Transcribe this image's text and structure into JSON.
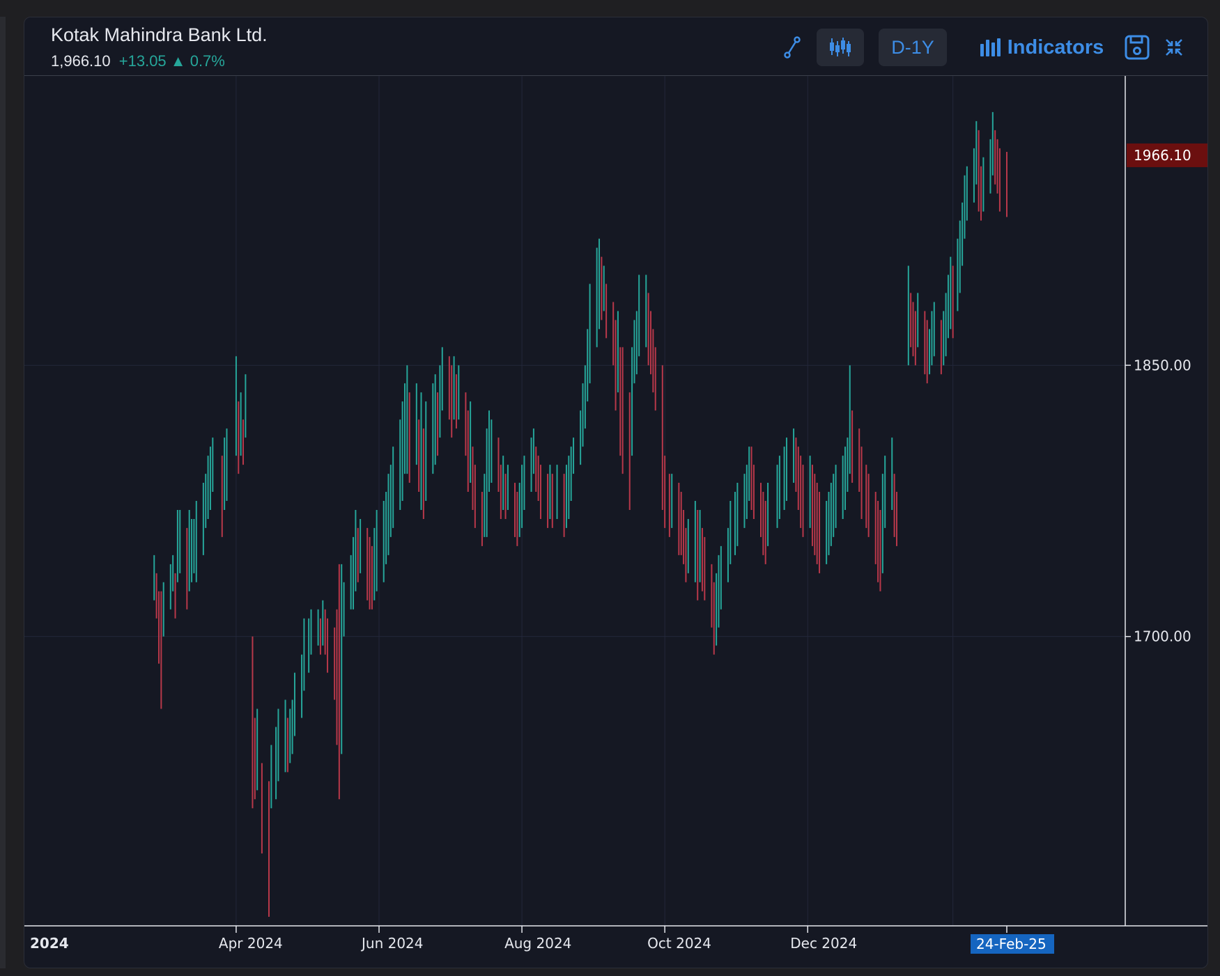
{
  "header": {
    "title": "Kotak Mahindra Bank Ltd.",
    "price": "1,966.10",
    "change": "+13.05",
    "change_pct": "0.7%"
  },
  "toolbar": {
    "period_label": "D-1Y",
    "indicators_label": "Indicators",
    "icons": [
      "draw-tool-icon",
      "candlestick-icon",
      "bar-chart-icon",
      "save-icon",
      "collapse-icon"
    ]
  },
  "colors": {
    "background": "#151823",
    "up": "#26a69a",
    "down": "#b8384a",
    "accent": "#3d8de6",
    "last_price_bg": "#6b0f0f",
    "date_badge_bg": "#1565c0"
  },
  "chart_data": {
    "type": "bar",
    "style": "ohlc-bars",
    "ylim": [
      1540,
      2010
    ],
    "y_ticks": [
      1850,
      1700
    ],
    "y_tick_labels": [
      "1850.00",
      "1700.00"
    ],
    "x_tick_labels": [
      "2024",
      "Apr 2024",
      "Jun 2024",
      "Aug 2024",
      "Oct 2024",
      "Dec 2024"
    ],
    "x_tick_dates": [
      "2024-01-01",
      "2024-04-01",
      "2024-06-01",
      "2024-08-01",
      "2024-10-01",
      "2024-12-01"
    ],
    "last_price_label": "1966.10",
    "last_date_label": "24-Feb-25",
    "grid": true,
    "bars": [
      [
        "2024-02-26",
        1745,
        1720
      ],
      [
        "2024-02-27",
        1735,
        1710
      ],
      [
        "2024-02-28",
        1725,
        1685
      ],
      [
        "2024-02-29",
        1725,
        1660
      ],
      [
        "2024-03-01",
        1730,
        1700
      ],
      [
        "2024-03-04",
        1740,
        1715
      ],
      [
        "2024-03-05",
        1745,
        1725
      ],
      [
        "2024-03-06",
        1735,
        1710
      ],
      [
        "2024-03-07",
        1770,
        1730
      ],
      [
        "2024-03-08",
        1770,
        1735
      ],
      [
        "2024-03-11",
        1760,
        1715
      ],
      [
        "2024-03-12",
        1770,
        1725
      ],
      [
        "2024-03-13",
        1765,
        1730
      ],
      [
        "2024-03-14",
        1765,
        1735
      ],
      [
        "2024-03-15",
        1775,
        1730
      ],
      [
        "2024-03-18",
        1785,
        1745
      ],
      [
        "2024-03-19",
        1790,
        1760
      ],
      [
        "2024-03-20",
        1800,
        1765
      ],
      [
        "2024-03-21",
        1805,
        1770
      ],
      [
        "2024-03-22",
        1810,
        1780
      ],
      [
        "2024-03-26",
        1800,
        1755
      ],
      [
        "2024-03-27",
        1810,
        1770
      ],
      [
        "2024-03-28",
        1815,
        1775
      ],
      [
        "2024-04-01",
        1855,
        1800
      ],
      [
        "2024-04-02",
        1830,
        1790
      ],
      [
        "2024-04-03",
        1835,
        1800
      ],
      [
        "2024-04-04",
        1820,
        1795
      ],
      [
        "2024-04-05",
        1845,
        1810
      ],
      [
        "2024-04-08",
        1700,
        1605
      ],
      [
        "2024-04-09",
        1655,
        1610
      ],
      [
        "2024-04-10",
        1660,
        1615
      ],
      [
        "2024-04-12",
        1630,
        1580
      ],
      [
        "2024-04-15",
        1620,
        1545
      ],
      [
        "2024-04-16",
        1640,
        1605
      ],
      [
        "2024-04-18",
        1650,
        1610
      ],
      [
        "2024-04-19",
        1660,
        1620
      ],
      [
        "2024-04-22",
        1665,
        1625
      ],
      [
        "2024-04-23",
        1655,
        1625
      ],
      [
        "2024-04-24",
        1660,
        1630
      ],
      [
        "2024-04-25",
        1665,
        1635
      ],
      [
        "2024-04-26",
        1680,
        1645
      ],
      [
        "2024-04-29",
        1690,
        1655
      ],
      [
        "2024-04-30",
        1710,
        1670
      ],
      [
        "2024-05-02",
        1710,
        1680
      ],
      [
        "2024-05-03",
        1715,
        1690
      ],
      [
        "2024-05-06",
        1715,
        1695
      ],
      [
        "2024-05-07",
        1710,
        1690
      ],
      [
        "2024-05-08",
        1720,
        1695
      ],
      [
        "2024-05-09",
        1715,
        1690
      ],
      [
        "2024-05-10",
        1710,
        1680
      ],
      [
        "2024-05-13",
        1705,
        1665
      ],
      [
        "2024-05-14",
        1715,
        1640
      ],
      [
        "2024-05-15",
        1740,
        1610
      ],
      [
        "2024-05-16",
        1740,
        1635
      ],
      [
        "2024-05-17",
        1730,
        1700
      ],
      [
        "2024-05-20",
        1745,
        1715
      ],
      [
        "2024-05-21",
        1755,
        1715
      ],
      [
        "2024-05-22",
        1770,
        1725
      ],
      [
        "2024-05-23",
        1760,
        1730
      ],
      [
        "2024-05-24",
        1765,
        1735
      ],
      [
        "2024-05-27",
        1760,
        1720
      ],
      [
        "2024-05-28",
        1755,
        1715
      ],
      [
        "2024-05-29",
        1750,
        1715
      ],
      [
        "2024-05-30",
        1760,
        1720
      ],
      [
        "2024-05-31",
        1770,
        1725
      ],
      [
        "2024-06-03",
        1775,
        1730
      ],
      [
        "2024-06-04",
        1780,
        1740
      ],
      [
        "2024-06-05",
        1790,
        1745
      ],
      [
        "2024-06-06",
        1795,
        1755
      ],
      [
        "2024-06-07",
        1805,
        1760
      ],
      [
        "2024-06-10",
        1820,
        1770
      ],
      [
        "2024-06-11",
        1830,
        1775
      ],
      [
        "2024-06-12",
        1840,
        1790
      ],
      [
        "2024-06-13",
        1850,
        1790
      ],
      [
        "2024-06-14",
        1835,
        1785
      ],
      [
        "2024-06-17",
        1840,
        1795
      ],
      [
        "2024-06-18",
        1820,
        1780
      ],
      [
        "2024-06-19",
        1835,
        1770
      ],
      [
        "2024-06-20",
        1815,
        1765
      ],
      [
        "2024-06-21",
        1830,
        1775
      ],
      [
        "2024-06-24",
        1840,
        1790
      ],
      [
        "2024-06-25",
        1845,
        1795
      ],
      [
        "2024-06-26",
        1835,
        1800
      ],
      [
        "2024-06-27",
        1850,
        1810
      ],
      [
        "2024-06-28",
        1860,
        1825
      ],
      [
        "2024-07-01",
        1855,
        1820
      ],
      [
        "2024-07-02",
        1850,
        1810
      ],
      [
        "2024-07-03",
        1855,
        1820
      ],
      [
        "2024-07-04",
        1845,
        1815
      ],
      [
        "2024-07-05",
        1850,
        1820
      ],
      [
        "2024-07-08",
        1835,
        1800
      ],
      [
        "2024-07-09",
        1825,
        1780
      ],
      [
        "2024-07-10",
        1830,
        1785
      ],
      [
        "2024-07-11",
        1805,
        1770
      ],
      [
        "2024-07-12",
        1795,
        1760
      ],
      [
        "2024-07-15",
        1780,
        1750
      ],
      [
        "2024-07-16",
        1790,
        1755
      ],
      [
        "2024-07-17",
        1815,
        1755
      ],
      [
        "2024-07-18",
        1825,
        1780
      ],
      [
        "2024-07-19",
        1820,
        1785
      ],
      [
        "2024-07-22",
        1810,
        1780
      ],
      [
        "2024-07-23",
        1795,
        1765
      ],
      [
        "2024-07-24",
        1800,
        1770
      ],
      [
        "2024-07-25",
        1790,
        1765
      ],
      [
        "2024-07-26",
        1795,
        1770
      ],
      [
        "2024-07-29",
        1785,
        1755
      ],
      [
        "2024-07-30",
        1780,
        1750
      ],
      [
        "2024-07-31",
        1785,
        1755
      ],
      [
        "2024-08-01",
        1795,
        1760
      ],
      [
        "2024-08-02",
        1800,
        1770
      ],
      [
        "2024-08-05",
        1810,
        1780
      ],
      [
        "2024-08-06",
        1815,
        1790
      ],
      [
        "2024-08-07",
        1805,
        1780
      ],
      [
        "2024-08-08",
        1800,
        1775
      ],
      [
        "2024-08-09",
        1795,
        1765
      ],
      [
        "2024-08-12",
        1790,
        1760
      ],
      [
        "2024-08-13",
        1795,
        1765
      ],
      [
        "2024-08-14",
        1790,
        1760
      ],
      [
        "2024-08-16",
        1795,
        1765
      ],
      [
        "2024-08-19",
        1790,
        1755
      ],
      [
        "2024-08-20",
        1795,
        1760
      ],
      [
        "2024-08-21",
        1800,
        1765
      ],
      [
        "2024-08-22",
        1805,
        1775
      ],
      [
        "2024-08-23",
        1810,
        1790
      ],
      [
        "2024-08-26",
        1825,
        1795
      ],
      [
        "2024-08-27",
        1840,
        1805
      ],
      [
        "2024-08-28",
        1850,
        1815
      ],
      [
        "2024-08-29",
        1870,
        1830
      ],
      [
        "2024-08-30",
        1895,
        1840
      ],
      [
        "2024-09-02",
        1915,
        1860
      ],
      [
        "2024-09-03",
        1920,
        1870
      ],
      [
        "2024-09-04",
        1910,
        1875
      ],
      [
        "2024-09-05",
        1905,
        1880
      ],
      [
        "2024-09-06",
        1895,
        1865
      ],
      [
        "2024-09-09",
        1885,
        1850
      ],
      [
        "2024-09-10",
        1875,
        1825
      ],
      [
        "2024-09-11",
        1880,
        1835
      ],
      [
        "2024-09-12",
        1860,
        1800
      ],
      [
        "2024-09-13",
        1860,
        1790
      ],
      [
        "2024-09-16",
        1835,
        1770
      ],
      [
        "2024-09-17",
        1860,
        1800
      ],
      [
        "2024-09-18",
        1875,
        1840
      ],
      [
        "2024-09-19",
        1880,
        1845
      ],
      [
        "2024-09-20",
        1900,
        1855
      ],
      [
        "2024-09-23",
        1900,
        1860
      ],
      [
        "2024-09-24",
        1890,
        1850
      ],
      [
        "2024-09-25",
        1880,
        1845
      ],
      [
        "2024-09-26",
        1870,
        1835
      ],
      [
        "2024-09-27",
        1860,
        1825
      ],
      [
        "2024-09-30",
        1850,
        1770
      ],
      [
        "2024-10-01",
        1800,
        1760
      ],
      [
        "2024-10-03",
        1790,
        1755
      ],
      [
        "2024-10-04",
        1790,
        1760
      ],
      [
        "2024-10-07",
        1785,
        1745
      ],
      [
        "2024-10-08",
        1780,
        1745
      ],
      [
        "2024-10-09",
        1770,
        1740
      ],
      [
        "2024-10-10",
        1760,
        1730
      ],
      [
        "2024-10-11",
        1765,
        1735
      ],
      [
        "2024-10-14",
        1775,
        1730
      ],
      [
        "2024-10-15",
        1770,
        1720
      ],
      [
        "2024-10-16",
        1770,
        1730
      ],
      [
        "2024-10-17",
        1760,
        1725
      ],
      [
        "2024-10-18",
        1755,
        1720
      ],
      [
        "2024-10-21",
        1740,
        1705
      ],
      [
        "2024-10-22",
        1730,
        1690
      ],
      [
        "2024-10-23",
        1735,
        1695
      ],
      [
        "2024-10-24",
        1745,
        1705
      ],
      [
        "2024-10-25",
        1750,
        1715
      ],
      [
        "2024-10-28",
        1760,
        1730
      ],
      [
        "2024-10-29",
        1775,
        1740
      ],
      [
        "2024-10-31",
        1780,
        1745
      ],
      [
        "2024-11-01",
        1785,
        1750
      ],
      [
        "2024-11-04",
        1790,
        1760
      ],
      [
        "2024-11-05",
        1795,
        1765
      ],
      [
        "2024-11-06",
        1805,
        1775
      ],
      [
        "2024-11-07",
        1805,
        1770
      ],
      [
        "2024-11-08",
        1795,
        1765
      ],
      [
        "2024-11-11",
        1785,
        1755
      ],
      [
        "2024-11-12",
        1780,
        1745
      ],
      [
        "2024-11-13",
        1775,
        1740
      ],
      [
        "2024-11-14",
        1785,
        1750
      ],
      [
        "2024-11-18",
        1795,
        1760
      ],
      [
        "2024-11-19",
        1800,
        1765
      ],
      [
        "2024-11-21",
        1805,
        1770
      ],
      [
        "2024-11-22",
        1810,
        1775
      ],
      [
        "2024-11-25",
        1815,
        1785
      ],
      [
        "2024-11-26",
        1810,
        1780
      ],
      [
        "2024-11-27",
        1805,
        1770
      ],
      [
        "2024-11-28",
        1800,
        1760
      ],
      [
        "2024-11-29",
        1795,
        1755
      ],
      [
        "2024-12-02",
        1800,
        1760
      ],
      [
        "2024-12-03",
        1795,
        1750
      ],
      [
        "2024-12-04",
        1790,
        1745
      ],
      [
        "2024-12-05",
        1785,
        1740
      ],
      [
        "2024-12-06",
        1780,
        1735
      ],
      [
        "2024-12-09",
        1775,
        1740
      ],
      [
        "2024-12-10",
        1780,
        1745
      ],
      [
        "2024-12-11",
        1785,
        1750
      ],
      [
        "2024-12-12",
        1790,
        1755
      ],
      [
        "2024-12-13",
        1795,
        1760
      ],
      [
        "2024-12-16",
        1800,
        1765
      ],
      [
        "2024-12-17",
        1805,
        1770
      ],
      [
        "2024-12-18",
        1810,
        1780
      ],
      [
        "2024-12-19",
        1850,
        1790
      ],
      [
        "2024-12-20",
        1825,
        1785
      ],
      [
        "2024-12-23",
        1815,
        1780
      ],
      [
        "2024-12-24",
        1805,
        1765
      ],
      [
        "2024-12-26",
        1795,
        1760
      ],
      [
        "2024-12-27",
        1790,
        1755
      ],
      [
        "2024-12-30",
        1780,
        1740
      ],
      [
        "2024-12-31",
        1775,
        1730
      ],
      [
        "2025-01-01",
        1770,
        1725
      ],
      [
        "2025-01-02",
        1790,
        1735
      ],
      [
        "2025-01-03",
        1800,
        1760
      ],
      [
        "2025-01-06",
        1810,
        1770
      ],
      [
        "2025-01-07",
        1790,
        1755
      ],
      [
        "2025-01-08",
        1780,
        1750
      ],
      [
        "2025-01-13",
        1905,
        1850
      ],
      [
        "2025-01-14",
        1890,
        1860
      ],
      [
        "2025-01-15",
        1885,
        1855
      ],
      [
        "2025-01-16",
        1880,
        1850
      ],
      [
        "2025-01-17",
        1890,
        1860
      ],
      [
        "2025-01-20",
        1880,
        1845
      ],
      [
        "2025-01-21",
        1875,
        1840
      ],
      [
        "2025-01-22",
        1870,
        1845
      ],
      [
        "2025-01-23",
        1880,
        1850
      ],
      [
        "2025-01-24",
        1885,
        1855
      ],
      [
        "2025-01-27",
        1875,
        1845
      ],
      [
        "2025-01-28",
        1880,
        1850
      ],
      [
        "2025-01-29",
        1890,
        1855
      ],
      [
        "2025-01-30",
        1900,
        1865
      ],
      [
        "2025-01-31",
        1910,
        1870
      ],
      [
        "2025-02-01",
        1905,
        1865
      ],
      [
        "2025-02-03",
        1920,
        1880
      ],
      [
        "2025-02-04",
        1930,
        1890
      ],
      [
        "2025-02-05",
        1940,
        1905
      ],
      [
        "2025-02-06",
        1955,
        1920
      ],
      [
        "2025-02-07",
        1960,
        1930
      ],
      [
        "2025-02-10",
        1970,
        1940
      ],
      [
        "2025-02-11",
        1985,
        1950
      ],
      [
        "2025-02-12",
        1980,
        1935
      ],
      [
        "2025-02-13",
        1960,
        1930
      ],
      [
        "2025-02-14",
        1965,
        1935
      ],
      [
        "2025-02-17",
        1975,
        1945
      ],
      [
        "2025-02-18",
        1990,
        1955
      ],
      [
        "2025-02-19",
        1980,
        1950
      ],
      [
        "2025-02-20",
        1975,
        1945
      ],
      [
        "2025-02-21",
        1970,
        1935
      ],
      [
        "2025-02-24",
        1968,
        1932
      ]
    ]
  }
}
